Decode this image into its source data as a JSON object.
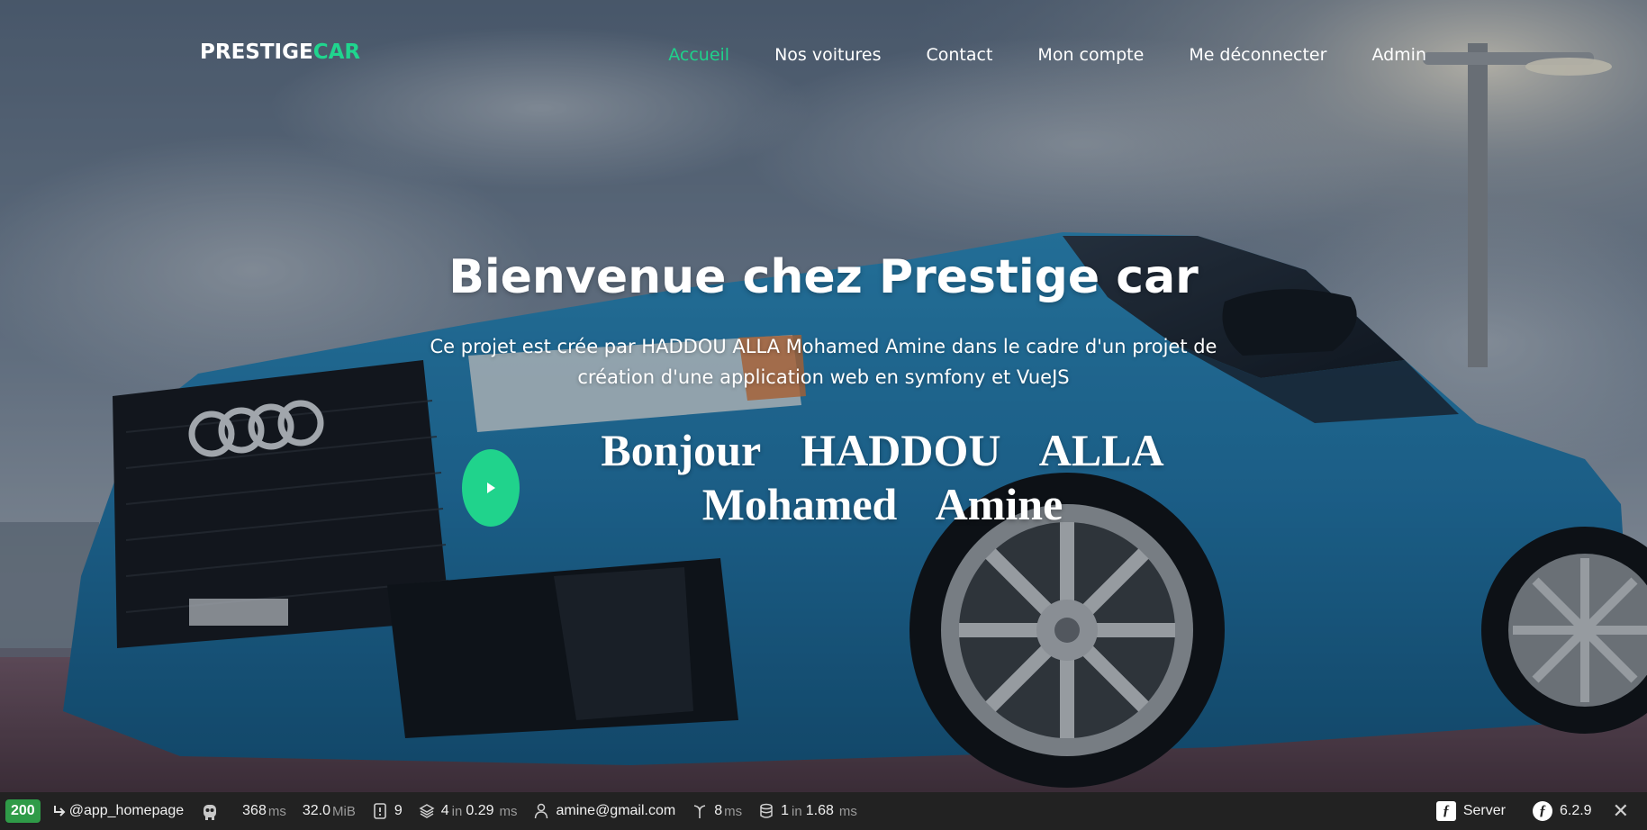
{
  "brand": {
    "part1": "PRESTIGE",
    "part2": "CAR"
  },
  "nav": {
    "items": [
      {
        "label": "Accueil",
        "active": true
      },
      {
        "label": "Nos voitures",
        "active": false
      },
      {
        "label": "Contact",
        "active": false
      },
      {
        "label": "Mon compte",
        "active": false
      },
      {
        "label": "Me déconnecter",
        "active": false
      },
      {
        "label": "Admin",
        "active": false
      }
    ]
  },
  "hero": {
    "title": "Bienvenue chez Prestige car",
    "subtitle": "Ce projet est crée par HADDOU ALLA Mohamed Amine dans le cadre d'un projet de création d'une application web en symfony et VueJS",
    "greeting_line1": "Bonjour  HADDOU  ALLA",
    "greeting_line2": "Mohamed  Amine",
    "play_icon": "play-icon"
  },
  "toolbar": {
    "status": "200",
    "route": "@app_homepage",
    "time_value": "368",
    "time_unit": "ms",
    "memory_value": "32.0",
    "memory_unit": "MiB",
    "logs_count": "9",
    "templates_count": "4",
    "templates_in": "in",
    "templates_time": "0.29",
    "templates_unit": "ms",
    "user": "amine@gmail.com",
    "events_value": "8",
    "events_unit": "ms",
    "db_count": "1",
    "db_in": "in",
    "db_time": "1.68",
    "db_unit": "ms",
    "server_label": "Server",
    "version": "6.2.9",
    "close": "✕"
  },
  "colors": {
    "accent": "#20d58e",
    "toolbar_bg": "#222222",
    "status_ok": "#2f9b48"
  }
}
